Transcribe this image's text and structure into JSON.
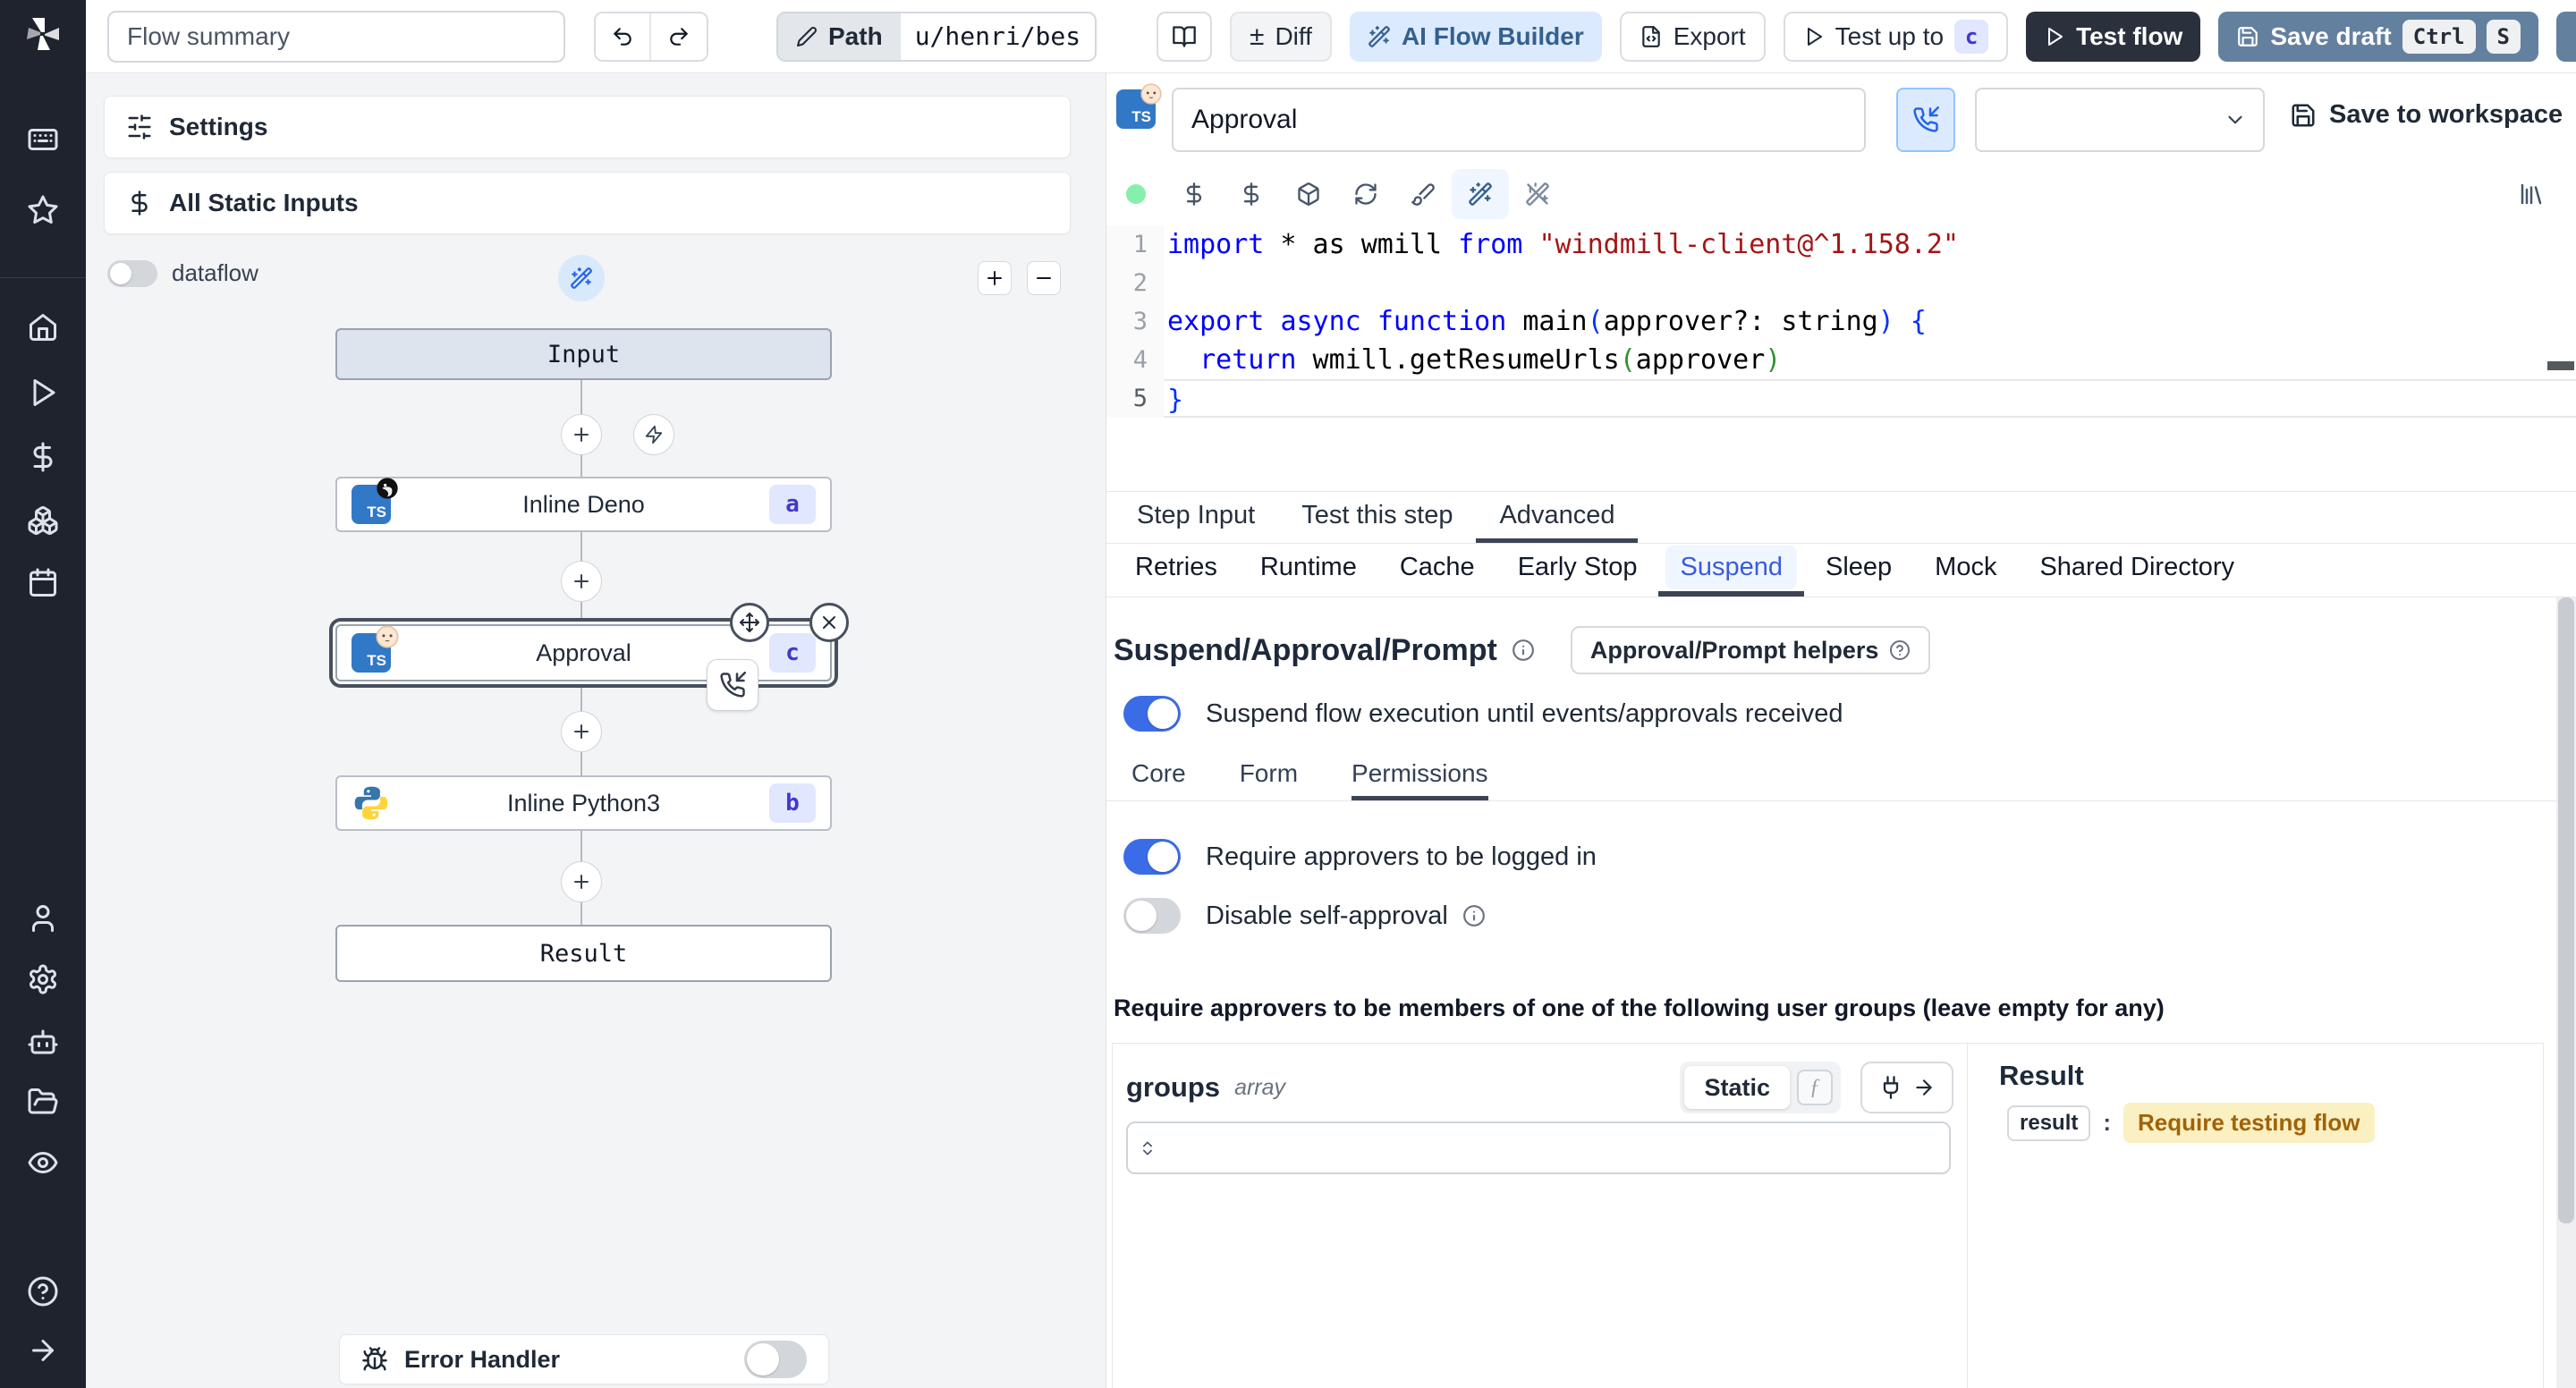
{
  "colors": {
    "sidebar_bg": "#1e232e",
    "panel_bg": "#f3f4f6",
    "accent_blue": "#3b6ce8",
    "ai_button_bg": "#dbeafe",
    "test_flow_bg": "#2a303c",
    "save_draft_bg": "#64809f",
    "badge_bg": "#e0e7ff",
    "badge_text": "#4338ca",
    "result_highlight_bg": "#fbf0c2",
    "result_highlight_text": "#a16207",
    "status_dot": "#86efac"
  },
  "topbar": {
    "flow_summary_value": "Flow summary",
    "path_label": "Path",
    "path_value": "u/henri/bes",
    "diff_label": "Diff",
    "diff_glyph": "±",
    "ai_flow_builder_label": "AI Flow Builder",
    "export_label": "Export",
    "test_up_to_label": "Test up to",
    "test_up_to_badge": "c",
    "test_flow_label": "Test flow",
    "save_draft_label": "Save draft",
    "save_draft_kbd_1": "Ctrl",
    "save_draft_kbd_2": "S"
  },
  "flow_panel": {
    "settings_label": "Settings",
    "static_inputs_label": "All Static Inputs",
    "dataflow_label": "dataflow",
    "zoom_in_glyph": "+",
    "zoom_out_glyph": "−",
    "nodes": {
      "input": {
        "label": "Input"
      },
      "deno": {
        "label": "Inline Deno",
        "badge": "a"
      },
      "approval": {
        "label": "Approval",
        "badge": "c"
      },
      "python": {
        "label": "Inline Python3",
        "badge": "b"
      },
      "result": {
        "label": "Result"
      }
    },
    "error_handler_label": "Error Handler"
  },
  "step": {
    "name_value": "Approval",
    "save_to_workspace_label": "Save to workspace",
    "code": {
      "lines": [
        {
          "n": "1",
          "tokens": [
            [
              "kw",
              "import"
            ],
            [
              "pl",
              " * as wmill "
            ],
            [
              "kw",
              "from"
            ],
            [
              "pl",
              " "
            ],
            [
              "str",
              "\"windmill-client@^1.158.2\""
            ]
          ]
        },
        {
          "n": "2",
          "tokens": []
        },
        {
          "n": "3",
          "tokens": [
            [
              "kw",
              "export"
            ],
            [
              "pl",
              " "
            ],
            [
              "kw",
              "async"
            ],
            [
              "pl",
              " "
            ],
            [
              "kw",
              "function"
            ],
            [
              "pl",
              " main"
            ],
            [
              "b1",
              "("
            ],
            [
              "pl",
              "approver?: string"
            ],
            [
              "b1",
              ")"
            ],
            [
              "pl",
              " "
            ],
            [
              "b1",
              "{"
            ]
          ]
        },
        {
          "n": "4",
          "tokens": [
            [
              "pl",
              "  "
            ],
            [
              "kw",
              "return"
            ],
            [
              "pl",
              " wmill.getResumeUrls"
            ],
            [
              "b2",
              "("
            ],
            [
              "pl",
              "approver"
            ],
            [
              "b2",
              ")"
            ]
          ]
        },
        {
          "n": "5",
          "tokens": [
            [
              "b1",
              "}"
            ]
          ],
          "current": true
        }
      ]
    },
    "tabs": [
      "Step Input",
      "Test this step",
      "Advanced"
    ],
    "subtabs": [
      "Retries",
      "Runtime",
      "Cache",
      "Early Stop",
      "Suspend",
      "Sleep",
      "Mock",
      "Shared Directory"
    ],
    "suspend": {
      "heading": "Suspend/Approval/Prompt",
      "helpers_button_label": "Approval/Prompt helpers",
      "suspend_toggle_label": "Suspend flow execution until events/approvals received",
      "seg_tabs": [
        "Core",
        "Form",
        "Permissions"
      ],
      "logged_in_toggle_label": "Require approvers to be logged in",
      "self_approval_toggle_label": "Disable self-approval",
      "groups_note": "Require approvers to be members of one of the following user groups (leave empty for any)",
      "groups_label": "groups",
      "groups_type": "array",
      "static_label": "Static",
      "fx_glyph": "ƒ",
      "result_title": "Result",
      "result_key": "result",
      "result_value": "Require testing flow"
    }
  }
}
